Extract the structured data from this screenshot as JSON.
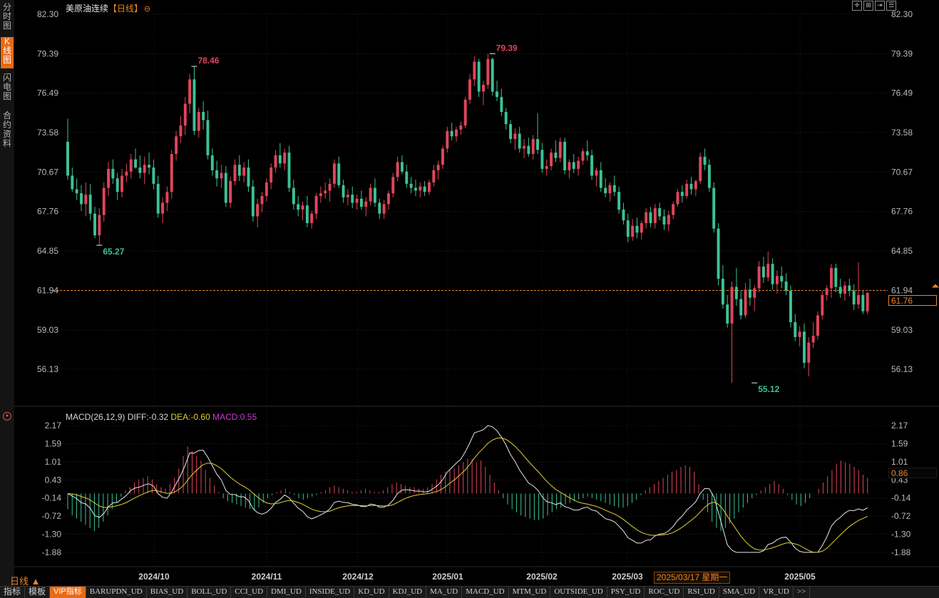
{
  "sidebar": {
    "items": [
      {
        "label": "分时图",
        "active": false
      },
      {
        "label": "K线图",
        "active": true
      },
      {
        "label": "闪电图",
        "active": false
      },
      {
        "label": "合约资料",
        "active": false
      }
    ]
  },
  "header": {
    "instrument": "美原油连续",
    "cycle": "【日线】",
    "settings_glyph": "⊖",
    "controls": [
      "crosshair-icon",
      "bar-compare-icon",
      "zoom-in-icon",
      "list-icon"
    ]
  },
  "price_axis": {
    "ticks": [
      "82.30",
      "79.39",
      "76.49",
      "73.58",
      "70.67",
      "67.76",
      "64.85",
      "61.94",
      "59.03",
      "56.13"
    ],
    "current_price": "61.76",
    "current_line_value": 61.94
  },
  "annotations": {
    "high_1": "78.46",
    "high_2": "79.39",
    "low_1": "65.27",
    "low_2": "55.12"
  },
  "macd": {
    "legend_label": "MACD(26,12,9)",
    "diff_label": "DIFF:-0.32",
    "dea_label": "DEA:-0.60",
    "macd_label": "MACD:0.55",
    "ticks": [
      "2.17",
      "1.59",
      "1.01",
      "0.43",
      "-0.14",
      "-0.72",
      "-1.30",
      "-1.88"
    ],
    "current_value": "0.86"
  },
  "time_axis": {
    "labels": [
      "2024/10",
      "2024/11",
      "2024/12",
      "2025/01",
      "2025/02",
      "2025/03",
      "2025/05"
    ],
    "crosshair_date": "2025/03/17 星期一",
    "cycle_label": "日线 ▲"
  },
  "colors": {
    "up": "#e0455a",
    "down": "#3cc296",
    "diff_line": "#e8e8e8",
    "dea_line": "#e0d23a",
    "accent": "#e86a14"
  },
  "tabbar": {
    "items": [
      "指标",
      "模板",
      "VIP指标",
      "BARUPDN_UD",
      "BIAS_UD",
      "BOLL_UD",
      "CCI_UD",
      "DMI_UD",
      "INSIDE_UD",
      "KD_UD",
      "KDJ_UD",
      "MA_UD",
      "MACD_UD",
      "MTM_UD",
      "OUTSIDE_UD",
      "PSY_UD",
      "ROC_UD",
      "RSI_UD",
      "SMA_UD",
      "VR_UD",
      ">>"
    ]
  },
  "chart_data": {
    "type": "candlestick",
    "title": "美原油连续【日线】",
    "y_range": [
      56.13,
      82.3
    ],
    "x_labels": [
      "2024/10",
      "2024/11",
      "2024/12",
      "2025/01",
      "2025/02",
      "2025/03",
      "2025/05"
    ],
    "highs_marked": [
      78.46,
      79.39
    ],
    "lows_marked": [
      65.27,
      55.12
    ],
    "last_price": 61.76,
    "candles": [
      [
        72.9,
        74.6,
        70.1,
        70.4
      ],
      [
        70.4,
        71.0,
        69.2,
        69.4
      ],
      [
        69.4,
        70.2,
        68.6,
        69.1
      ],
      [
        69.1,
        69.7,
        67.8,
        68.3
      ],
      [
        68.3,
        69.9,
        67.4,
        69.0
      ],
      [
        69.0,
        69.8,
        67.1,
        67.6
      ],
      [
        67.6,
        68.1,
        65.8,
        66.0
      ],
      [
        66.0,
        68.0,
        65.27,
        67.5
      ],
      [
        67.5,
        69.9,
        67.0,
        69.5
      ],
      [
        69.5,
        71.4,
        68.9,
        70.9
      ],
      [
        70.9,
        71.6,
        69.8,
        70.2
      ],
      [
        70.2,
        70.6,
        68.6,
        69.2
      ],
      [
        69.2,
        70.9,
        68.8,
        70.4
      ],
      [
        70.4,
        71.3,
        69.9,
        70.7
      ],
      [
        70.7,
        72.0,
        70.2,
        71.6
      ],
      [
        71.6,
        72.4,
        70.9,
        71.0
      ],
      [
        71.0,
        71.9,
        70.2,
        70.6
      ],
      [
        70.6,
        71.8,
        69.8,
        71.2
      ],
      [
        71.2,
        72.1,
        70.5,
        71.0
      ],
      [
        71.0,
        71.6,
        69.4,
        69.8
      ],
      [
        69.8,
        70.4,
        67.3,
        67.6
      ],
      [
        67.6,
        68.8,
        66.9,
        68.4
      ],
      [
        68.4,
        69.6,
        67.8,
        69.2
      ],
      [
        69.2,
        72.3,
        68.7,
        72.0
      ],
      [
        72.0,
        73.7,
        71.5,
        73.3
      ],
      [
        73.3,
        74.8,
        72.8,
        74.1
      ],
      [
        74.1,
        76.2,
        73.4,
        75.7
      ],
      [
        75.7,
        77.9,
        75.0,
        77.5
      ],
      [
        77.5,
        78.46,
        73.4,
        73.7
      ],
      [
        73.7,
        75.4,
        73.2,
        75.1
      ],
      [
        75.1,
        75.9,
        73.8,
        74.5
      ],
      [
        74.5,
        75.2,
        71.6,
        71.9
      ],
      [
        71.9,
        72.4,
        70.4,
        70.8
      ],
      [
        70.8,
        71.5,
        69.6,
        70.2
      ],
      [
        70.2,
        71.2,
        69.5,
        70.6
      ],
      [
        70.6,
        71.1,
        68.1,
        68.4
      ],
      [
        68.4,
        70.3,
        68.0,
        70.0
      ],
      [
        70.0,
        71.6,
        69.7,
        71.2
      ],
      [
        71.2,
        71.9,
        70.0,
        70.4
      ],
      [
        70.4,
        71.4,
        69.9,
        71.0
      ],
      [
        71.0,
        71.6,
        69.2,
        69.6
      ],
      [
        69.6,
        70.1,
        67.0,
        67.4
      ],
      [
        67.4,
        68.7,
        66.6,
        68.3
      ],
      [
        68.3,
        69.2,
        67.7,
        68.9
      ],
      [
        68.9,
        70.2,
        68.5,
        69.9
      ],
      [
        69.9,
        71.3,
        69.4,
        71.0
      ],
      [
        71.0,
        72.3,
        70.6,
        71.9
      ],
      [
        71.9,
        72.8,
        71.0,
        71.3
      ],
      [
        71.3,
        72.4,
        70.8,
        72.1
      ],
      [
        72.1,
        72.6,
        69.2,
        69.5
      ],
      [
        69.5,
        70.1,
        67.9,
        68.3
      ],
      [
        68.3,
        68.9,
        67.4,
        67.9
      ],
      [
        67.9,
        68.5,
        67.1,
        68.2
      ],
      [
        68.2,
        68.9,
        66.6,
        66.9
      ],
      [
        66.9,
        67.8,
        66.5,
        67.6
      ],
      [
        67.6,
        69.1,
        67.2,
        68.9
      ],
      [
        68.9,
        69.6,
        68.4,
        69.1
      ],
      [
        69.1,
        69.9,
        68.7,
        69.3
      ],
      [
        69.3,
        70.2,
        68.5,
        69.8
      ],
      [
        69.8,
        71.6,
        69.5,
        71.3
      ],
      [
        71.3,
        71.8,
        69.5,
        69.7
      ],
      [
        69.7,
        70.1,
        68.4,
        68.8
      ],
      [
        68.8,
        69.4,
        68.2,
        69.0
      ],
      [
        69.0,
        69.6,
        68.0,
        68.4
      ],
      [
        68.4,
        69.0,
        67.9,
        68.7
      ],
      [
        68.7,
        69.3,
        67.9,
        68.1
      ],
      [
        68.1,
        68.8,
        67.4,
        68.5
      ],
      [
        68.5,
        69.8,
        68.2,
        69.5
      ],
      [
        69.5,
        70.2,
        68.1,
        68.4
      ],
      [
        68.4,
        68.7,
        67.2,
        67.6
      ],
      [
        67.6,
        68.6,
        67.2,
        68.3
      ],
      [
        68.3,
        69.3,
        67.9,
        69.1
      ],
      [
        69.1,
        70.6,
        68.8,
        70.3
      ],
      [
        70.3,
        71.8,
        70.0,
        71.4
      ],
      [
        71.4,
        71.9,
        70.5,
        70.7
      ],
      [
        70.7,
        71.2,
        69.5,
        69.8
      ],
      [
        69.8,
        70.3,
        69.1,
        69.5
      ],
      [
        69.5,
        70.1,
        68.9,
        69.3
      ],
      [
        69.3,
        69.9,
        68.8,
        69.6
      ],
      [
        69.6,
        70.0,
        68.9,
        69.2
      ],
      [
        69.2,
        70.1,
        69.0,
        69.9
      ],
      [
        69.9,
        71.2,
        69.6,
        70.8
      ],
      [
        70.8,
        71.5,
        70.1,
        71.2
      ],
      [
        71.2,
        72.6,
        70.9,
        72.4
      ],
      [
        72.4,
        74.0,
        72.1,
        73.7
      ],
      [
        73.7,
        74.3,
        73.0,
        73.3
      ],
      [
        73.3,
        74.0,
        72.9,
        73.8
      ],
      [
        73.8,
        74.4,
        73.4,
        74.1
      ],
      [
        74.1,
        76.2,
        73.9,
        76.0
      ],
      [
        76.0,
        77.9,
        75.7,
        77.5
      ],
      [
        77.5,
        79.2,
        77.0,
        78.8
      ],
      [
        78.8,
        79.0,
        76.2,
        76.6
      ],
      [
        76.6,
        77.4,
        75.6,
        77.1
      ],
      [
        77.1,
        79.39,
        76.8,
        79.0
      ],
      [
        79.0,
        79.1,
        76.3,
        76.6
      ],
      [
        76.6,
        77.4,
        75.9,
        76.2
      ],
      [
        76.2,
        76.8,
        74.8,
        75.1
      ],
      [
        75.1,
        75.4,
        73.8,
        74.2
      ],
      [
        74.2,
        74.5,
        72.8,
        73.1
      ],
      [
        73.1,
        73.9,
        72.3,
        73.5
      ],
      [
        73.5,
        74.0,
        72.1,
        72.4
      ],
      [
        72.4,
        73.1,
        71.7,
        72.6
      ],
      [
        72.6,
        73.2,
        71.8,
        72.0
      ],
      [
        72.0,
        73.4,
        71.6,
        73.1
      ],
      [
        73.1,
        75.0,
        72.0,
        72.3
      ],
      [
        72.3,
        72.8,
        70.6,
        70.9
      ],
      [
        70.9,
        71.6,
        70.4,
        71.1
      ],
      [
        71.1,
        72.4,
        70.8,
        72.1
      ],
      [
        72.1,
        73.0,
        71.4,
        71.7
      ],
      [
        71.7,
        73.2,
        71.4,
        72.9
      ],
      [
        72.9,
        73.2,
        70.5,
        70.8
      ],
      [
        70.8,
        71.6,
        70.2,
        71.4
      ],
      [
        71.4,
        72.0,
        70.6,
        70.9
      ],
      [
        70.9,
        71.8,
        70.4,
        71.5
      ],
      [
        71.5,
        72.4,
        71.2,
        72.2
      ],
      [
        72.2,
        73.0,
        71.5,
        71.9
      ],
      [
        71.9,
        72.3,
        70.1,
        70.4
      ],
      [
        70.4,
        71.0,
        69.6,
        70.8
      ],
      [
        70.8,
        71.4,
        69.2,
        69.5
      ],
      [
        69.5,
        70.2,
        68.8,
        69.1
      ],
      [
        69.1,
        69.9,
        68.5,
        69.7
      ],
      [
        69.7,
        70.4,
        68.9,
        69.2
      ],
      [
        69.2,
        69.6,
        67.6,
        67.9
      ],
      [
        67.9,
        68.4,
        66.8,
        67.1
      ],
      [
        67.1,
        67.6,
        65.5,
        65.9
      ],
      [
        65.9,
        67.2,
        65.6,
        66.7
      ],
      [
        66.7,
        67.3,
        65.8,
        66.2
      ],
      [
        66.2,
        67.1,
        65.7,
        66.9
      ],
      [
        66.9,
        68.0,
        66.5,
        67.7
      ],
      [
        67.7,
        68.1,
        66.6,
        66.9
      ],
      [
        66.9,
        68.3,
        66.5,
        68.0
      ],
      [
        68.0,
        68.4,
        67.1,
        67.4
      ],
      [
        67.4,
        67.9,
        66.4,
        66.8
      ],
      [
        66.8,
        67.8,
        66.3,
        67.5
      ],
      [
        67.5,
        68.5,
        67.2,
        68.3
      ],
      [
        68.3,
        69.4,
        68.1,
        69.2
      ],
      [
        69.2,
        69.7,
        68.4,
        68.9
      ],
      [
        68.9,
        70.1,
        68.7,
        69.8
      ],
      [
        69.8,
        70.3,
        69.0,
        69.4
      ],
      [
        69.4,
        70.1,
        68.9,
        70.0
      ],
      [
        70.0,
        72.1,
        69.8,
        71.8
      ],
      [
        71.8,
        72.4,
        70.8,
        71.2
      ],
      [
        71.2,
        71.6,
        69.2,
        69.5
      ],
      [
        69.5,
        69.9,
        66.2,
        66.5
      ],
      [
        66.5,
        66.9,
        62.3,
        62.8
      ],
      [
        62.8,
        63.8,
        60.6,
        60.9
      ],
      [
        60.9,
        61.6,
        59.2,
        59.5
      ],
      [
        59.5,
        62.6,
        55.12,
        62.2
      ],
      [
        62.2,
        63.6,
        60.8,
        61.3
      ],
      [
        61.3,
        61.9,
        59.8,
        60.1
      ],
      [
        60.1,
        62.5,
        59.9,
        62.0
      ],
      [
        62.0,
        62.8,
        60.8,
        61.4
      ],
      [
        61.4,
        62.3,
        60.4,
        62.1
      ],
      [
        62.1,
        64.1,
        61.8,
        63.7
      ],
      [
        63.7,
        64.4,
        62.5,
        62.9
      ],
      [
        62.9,
        64.8,
        62.6,
        63.9
      ],
      [
        63.9,
        64.3,
        62.0,
        62.4
      ],
      [
        62.4,
        63.4,
        61.7,
        63.0
      ],
      [
        63.0,
        63.7,
        62.1,
        62.6
      ],
      [
        62.6,
        63.2,
        61.6,
        61.9
      ],
      [
        61.9,
        62.3,
        59.2,
        59.6
      ],
      [
        59.6,
        60.2,
        58.2,
        58.5
      ],
      [
        58.5,
        59.3,
        57.8,
        58.9
      ],
      [
        58.9,
        59.5,
        56.2,
        56.6
      ],
      [
        56.6,
        58.5,
        55.6,
        58.1
      ],
      [
        58.1,
        59.6,
        57.7,
        58.6
      ],
      [
        58.6,
        60.4,
        58.3,
        60.1
      ],
      [
        60.1,
        61.9,
        59.8,
        61.6
      ],
      [
        61.6,
        62.3,
        61.2,
        62.1
      ],
      [
        62.1,
        63.9,
        61.4,
        63.6
      ],
      [
        63.6,
        63.9,
        61.8,
        62.2
      ],
      [
        62.2,
        62.8,
        61.4,
        61.7
      ],
      [
        61.7,
        62.6,
        61.2,
        62.3
      ],
      [
        62.3,
        62.8,
        61.5,
        61.9
      ],
      [
        61.9,
        62.4,
        60.5,
        60.9
      ],
      [
        60.9,
        64.0,
        60.6,
        61.6
      ],
      [
        61.6,
        61.9,
        60.2,
        60.4
      ],
      [
        60.4,
        61.8,
        60.2,
        61.76
      ]
    ],
    "macd_hist": [
      -0.5,
      -0.7,
      -0.8,
      -0.9,
      -1.0,
      -1.1,
      -1.2,
      -1.1,
      -0.9,
      -0.7,
      -0.5,
      -0.3,
      -0.1,
      0.1,
      0.2,
      0.35,
      0.45,
      0.5,
      0.55,
      0.45,
      0.3,
      0.2,
      0.15,
      0.3,
      0.5,
      0.8,
      1.2,
      1.5,
      1.35,
      1.2,
      1.05,
      0.75,
      0.5,
      0.25,
      0.05,
      -0.15,
      -0.25,
      -0.3,
      -0.35,
      -0.4,
      -0.45,
      -0.5,
      -0.55,
      -0.45,
      -0.3,
      -0.15,
      -0.05,
      0.05,
      0.1,
      0.15,
      0.05,
      -0.05,
      -0.15,
      -0.2,
      -0.15,
      -0.1,
      -0.05,
      0.05,
      0.1,
      0.2,
      0.25,
      0.2,
      0.15,
      0.1,
      0.05,
      0.05,
      0.1,
      0.15,
      0.1,
      0.05,
      0.05,
      0.1,
      0.2,
      0.3,
      0.35,
      0.3,
      0.25,
      0.2,
      0.2,
      0.15,
      0.15,
      0.2,
      0.3,
      0.45,
      0.6,
      0.7,
      0.75,
      0.8,
      0.9,
      1.0,
      1.1,
      1.1,
      1.0,
      1.05,
      0.85,
      0.6,
      0.35,
      0.1,
      -0.15,
      -0.35,
      -0.5,
      -0.6,
      -0.7,
      -0.75,
      -0.8,
      -0.85,
      -0.85,
      -0.8,
      -0.7,
      -0.6,
      -0.5,
      -0.45,
      -0.35,
      -0.3,
      -0.25,
      -0.2,
      -0.15,
      -0.1,
      -0.15,
      -0.2,
      -0.25,
      -0.3,
      -0.35,
      -0.4,
      -0.45,
      -0.45,
      -0.4,
      -0.3,
      -0.2,
      -0.05,
      0.1,
      0.2,
      0.3,
      0.4,
      0.5,
      0.6,
      0.7,
      0.75,
      0.85,
      0.9,
      0.85,
      0.7,
      0.3,
      -0.2,
      -0.6,
      -0.9,
      -1.1,
      -1.2,
      -1.1,
      -0.95,
      -0.8,
      -0.6,
      -0.45,
      -0.3,
      -0.15,
      -0.05,
      0.1,
      0.2,
      0.3,
      0.4,
      0.3,
      0.15,
      -0.05,
      -0.2,
      -0.35,
      -0.4,
      -0.3,
      -0.15,
      0.0,
      0.15,
      0.35,
      0.55,
      0.75,
      0.95,
      1.05,
      1.0,
      0.95,
      0.85,
      0.75,
      0.6,
      0.5
    ]
  }
}
